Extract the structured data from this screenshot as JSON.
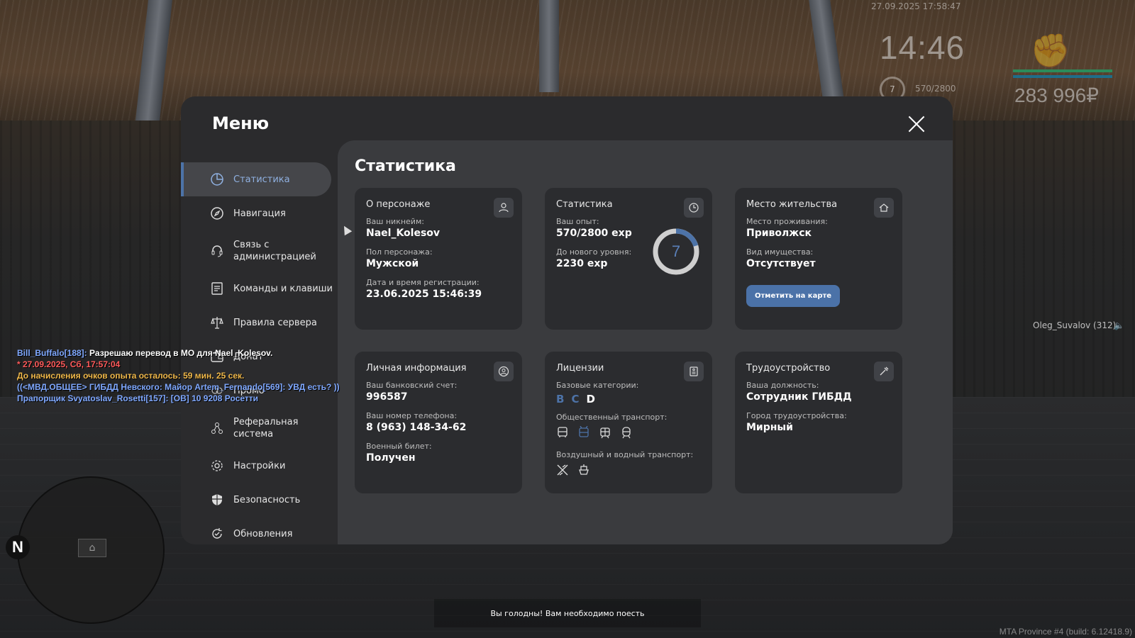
{
  "hud": {
    "datetime": "27.09.2025 17:58:47",
    "clock": "14:46",
    "level": "7",
    "exp": "570/2800",
    "money": "283 996₽",
    "player_voice": "Oleg_Suvalov (312)"
  },
  "modal": {
    "title": "Меню",
    "content_title": "Статистика"
  },
  "sidebar": {
    "items": [
      {
        "label": "Статистика",
        "icon": "pie-chart-icon"
      },
      {
        "label": "Навигация",
        "icon": "compass-icon"
      },
      {
        "label": "Связь с администрацией",
        "icon": "headset-icon"
      },
      {
        "label": "Команды и клавиши",
        "icon": "list-icon"
      },
      {
        "label": "Правила сервера",
        "icon": "scales-icon"
      },
      {
        "label": "Донат",
        "icon": "wallet-icon"
      },
      {
        "label": "Промо",
        "icon": "gift-icon"
      },
      {
        "label": "Реферальная система",
        "icon": "network-icon"
      },
      {
        "label": "Настройки",
        "icon": "gear-icon"
      },
      {
        "label": "Безопасность",
        "icon": "shield-icon"
      },
      {
        "label": "Обновления",
        "icon": "refresh-icon"
      }
    ]
  },
  "cards": {
    "character": {
      "title": "О персонаже",
      "nick_label": "Ваш никнейм:",
      "nick": "Nael_Kolesov",
      "gender_label": "Пол персонажа:",
      "gender": "Мужской",
      "reg_label": "Дата и время регистрации:",
      "reg": "23.06.2025 15:46:39"
    },
    "stats": {
      "title": "Статистика",
      "exp_label": "Ваш опыт:",
      "exp": "570/2800 exp",
      "next_label": "До нового уровня:",
      "next": "2230 exp",
      "level": "7",
      "progress": 0.2036
    },
    "residence": {
      "title": "Место жительства",
      "place_label": "Место проживания:",
      "place": "Приволжск",
      "property_label": "Вид имущества:",
      "property": "Отсутствует",
      "button": "Отметить на карте"
    },
    "personal": {
      "title": "Личная информация",
      "bank_label": "Ваш банковский счет:",
      "bank": "996587",
      "phone_label": "Ваш номер телефона:",
      "phone": "8 (963) 148-34-62",
      "military_label": "Военный билет:",
      "military": "Получен"
    },
    "licenses": {
      "title": "Лицензии",
      "base_label": "Базовые категории:",
      "cat_b": "B",
      "cat_c": "C",
      "cat_d": "D",
      "public_label": "Общественный транспорт:",
      "air_label": "Воздушный и водный транспорт:"
    },
    "employment": {
      "title": "Трудоустройство",
      "position_label": "Ваша должность:",
      "position": "Сотрудник ГИБДД",
      "city_label": "Город трудоустройства:",
      "city": "Мирный"
    }
  },
  "chat": [
    {
      "prefix": "Bill_Buffalo[188]:",
      "text": " Разрешаю перевод в МО для Nael_Kolesov.",
      "color": "#ffffff",
      "prefix_color": "#7fa8ff"
    },
    {
      "prefix": "",
      "text": "* 27.09.2025, Сб, 17:57:04",
      "color": "#ff5a5a"
    },
    {
      "prefix": "",
      "text": "До начисления очков опыта осталось: 59 мин. 25 сек.",
      "color": "#f0b84a"
    },
    {
      "prefix": "",
      "text": "((<МВД.ОБЩЕЕ> ГИБДД Невского: Майор Artem_Fernando[569]: УВД есть? ))",
      "color": "#7fa8ff"
    },
    {
      "prefix": "",
      "text": "Прапорщик Svyatoslav_Rosetti[157]: [ОВ] 10 9208 Росетти",
      "color": "#7fa8ff"
    }
  ],
  "hunger_message": "Вы голодны! Вам необходимо поесть",
  "build_info": "MTA Province #4 (build: 6.12418.9)",
  "colors": {
    "accent": "#4d73a8",
    "panel": "#2b2b2d",
    "content": "#3a3b3e",
    "card": "#2b2c2f"
  }
}
